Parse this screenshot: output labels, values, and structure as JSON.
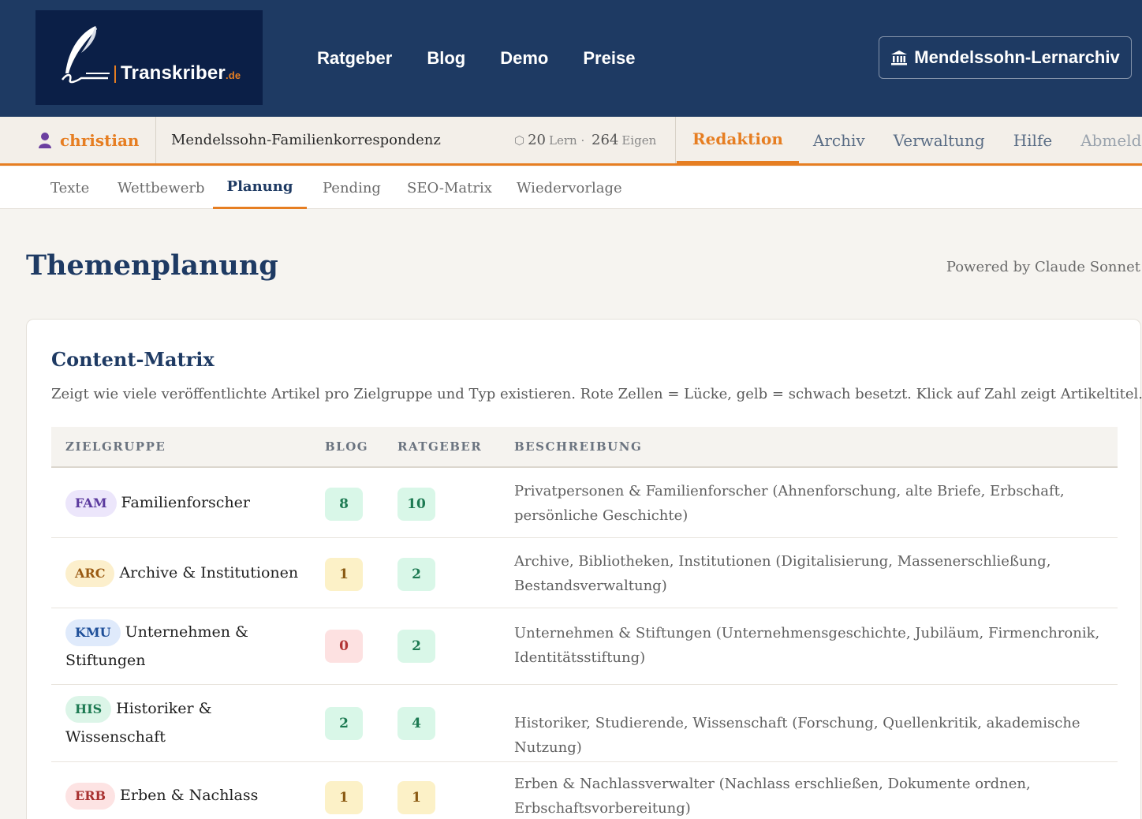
{
  "header": {
    "logo_text": "Transkriber",
    "logo_tld": ".de",
    "nav": [
      "Ratgeber",
      "Blog",
      "Demo",
      "Preise"
    ],
    "archive_button": "Mendelssohn-Lernarchiv"
  },
  "subbar": {
    "user": "christian",
    "project": "Mendelssohn-Familienkorrespondenz",
    "lern_count": "20",
    "lern_label": "Lern",
    "eigen_count": "264",
    "eigen_label": "Eigen",
    "nav": [
      "Redaktion",
      "Archiv",
      "Verwaltung",
      "Hilfe",
      "Abmelden"
    ],
    "active_nav": "Redaktion"
  },
  "tabs": {
    "items": [
      "Texte",
      "Wettbewerb",
      "Planung",
      "Pending",
      "SEO-Matrix",
      "Wiedervorlage"
    ],
    "active": "Planung"
  },
  "page": {
    "title": "Themenplanung",
    "powered_by": "Powered by Claude Sonnet"
  },
  "matrix": {
    "title": "Content-Matrix",
    "description": "Zeigt wie viele veröffentlichte Artikel pro Zielgruppe und Typ existieren. Rote Zellen = Lücke, gelb = schwach besetzt. Klick auf Zahl zeigt Artikeltitel.",
    "headers": [
      "ZIELGRUPPE",
      "BLOG",
      "RATGEBER",
      "BESCHREIBUNG"
    ],
    "rows": [
      {
        "code": "FAM",
        "name": "Familienforscher",
        "blog": "8",
        "ratgeber": "10",
        "description": "Privatpersonen & Familienforscher (Ahnenforschung, alte Briefe, Erbschaft, persönliche Geschichte)",
        "badge_bg": "#ece6fb",
        "badge_fg": "#5b3a9e",
        "blog_status": "green",
        "ratgeber_status": "green"
      },
      {
        "code": "ARC",
        "name": "Archive & Institutionen",
        "blog": "1",
        "ratgeber": "2",
        "description": "Archive, Bibliotheken, Institutionen (Digitalisierung, Massenerschließung, Bestandsverwaltung)",
        "badge_bg": "#fcefcc",
        "badge_fg": "#9a5a12",
        "blog_status": "yellow",
        "ratgeber_status": "green"
      },
      {
        "code": "KMU",
        "name": "Unternehmen & Stiftungen",
        "blog": "0",
        "ratgeber": "2",
        "description": "Unternehmen & Stiftungen (Unternehmensgeschichte, Jubiläum, Firmenchronik, Identitätsstiftung)",
        "badge_bg": "#dfeafb",
        "badge_fg": "#1e4f99",
        "blog_status": "red",
        "ratgeber_status": "green"
      },
      {
        "code": "HIS",
        "name": "Historiker & Wissenschaft",
        "blog": "2",
        "ratgeber": "4",
        "description": "Historiker, Studierende, Wissenschaft (Forschung, Quellenkritik, akademische Nutzung)",
        "badge_bg": "#dcf5e8",
        "badge_fg": "#1d7a52",
        "blog_status": "green",
        "ratgeber_status": "green"
      },
      {
        "code": "ERB",
        "name": "Erben & Nachlass",
        "blog": "1",
        "ratgeber": "1",
        "description": "Erben & Nachlassverwalter (Nachlass erschließen, Dokumente ordnen, Erbschaftsvorbereitung)",
        "badge_bg": "#fde3e3",
        "badge_fg": "#a8302f",
        "blog_status": "yellow",
        "ratgeber_status": "yellow"
      }
    ]
  }
}
